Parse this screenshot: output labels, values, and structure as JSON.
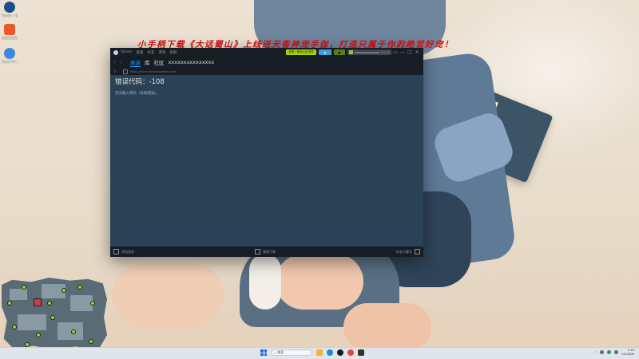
{
  "banner": {
    "text": "小手柄下载《大话蜀山》上线送天香神宠手伽，打造只属于你的绝世好宠！"
  },
  "desktop_icons": [
    {
      "label": "Steam - 快捷方式",
      "color": "#1b4f8a"
    },
    {
      "label": "新建文件夹",
      "color": "#e65a2a"
    },
    {
      "label": "FlashFXP 安装程序",
      "color": "#3c8ad8"
    }
  ],
  "steam": {
    "titlebar": {
      "menu": [
        "Steam",
        "查看",
        "好友",
        "游戏",
        "帮助"
      ],
      "announce_label": "查看一条新公告消息",
      "account_name": "xxxxxxxxxxxxxxx",
      "account_balance": "¥ 0.00",
      "window_controls": [
        "▭",
        "—",
        "□",
        "✕"
      ]
    },
    "nav": {
      "tabs": [
        "商店",
        "库",
        "社区",
        "xxxxxxxxxxxxxxx"
      ],
      "active_tab_index": 0
    },
    "urlbar": {
      "url": "https://store.steampowered.com/"
    },
    "content": {
      "error_title": "错误代码：-108",
      "error_message": "无法载入网页（未知错误）。"
    },
    "statusbar": {
      "add_game": "添加游戏",
      "manage_downloads": "管理下载",
      "friends_chat": "好友与聊天"
    },
    "colors": {
      "bg": "#1b2838",
      "content": "#2a4255",
      "accent": "#1a9fff"
    }
  },
  "taskbar": {
    "search_placeholder": "搜索",
    "time": "9:16",
    "date": "2024/6/6",
    "apps": [
      "file-explorer",
      "edge-browser",
      "steam",
      "chrome",
      "game-app"
    ]
  }
}
